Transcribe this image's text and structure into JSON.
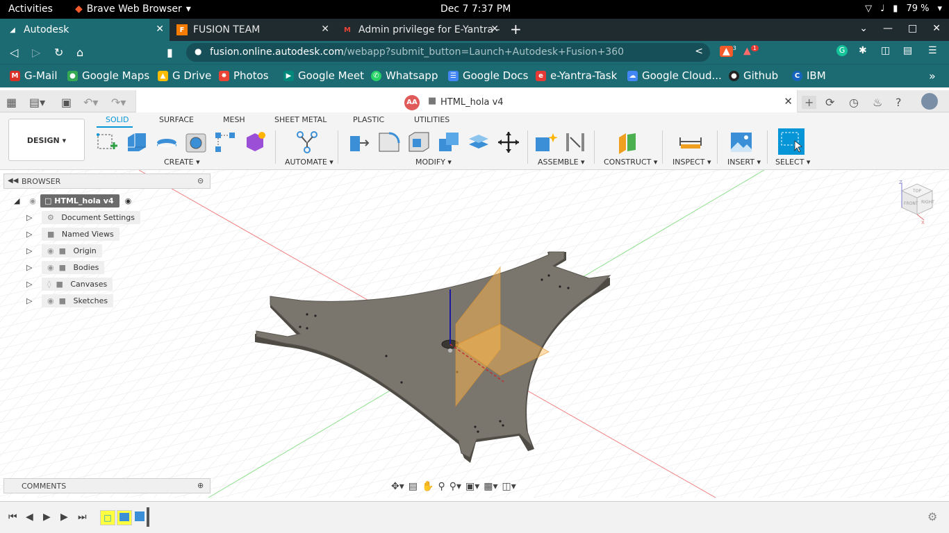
{
  "system": {
    "activities": "Activities",
    "app_name": "Brave Web Browser",
    "clock": "Dec 7   7:37 PM",
    "battery": "79 %"
  },
  "tabs": [
    {
      "title": "Autodesk",
      "active": true
    },
    {
      "title": "FUSION TEAM",
      "active": false
    },
    {
      "title": "Admin privilege for E-Yantra -",
      "active": false
    }
  ],
  "address": {
    "host": "fusion.online.autodesk.com",
    "path": "/webapp?submit_button=Launch+Autodesk+Fusion+360"
  },
  "extensions": {
    "brave_count": "3",
    "alert_count": "1"
  },
  "bookmarks": [
    {
      "label": "G-Mail",
      "color": "#d93025"
    },
    {
      "label": "Google Maps",
      "color": "#34a853"
    },
    {
      "label": "G Drive",
      "color": "#fbbc04"
    },
    {
      "label": "Photos",
      "color": "#ea4335"
    },
    {
      "label": "Google Meet",
      "color": "#00897b"
    },
    {
      "label": "Whatsapp",
      "color": "#25d366"
    },
    {
      "label": "Google Docs",
      "color": "#4285f4"
    },
    {
      "label": "e-Yantra-Task",
      "color": "#e53935"
    },
    {
      "label": "Google Cloud...",
      "color": "#4285f4"
    },
    {
      "label": "Github",
      "color": "#222222"
    },
    {
      "label": "IBM",
      "color": "#1565c0"
    }
  ],
  "app": {
    "user_initials": "AA",
    "doc_name": "HTML_hola v4"
  },
  "ribbon": {
    "workspace": "DESIGN",
    "tabs": [
      "SOLID",
      "SURFACE",
      "MESH",
      "SHEET METAL",
      "PLASTIC",
      "UTILITIES"
    ],
    "groups": [
      "CREATE",
      "AUTOMATE",
      "MODIFY",
      "ASSEMBLE",
      "CONSTRUCT",
      "INSPECT",
      "INSERT",
      "SELECT"
    ]
  },
  "browser_panel": {
    "title": "BROWSER",
    "root": "HTML_hola v4",
    "items": [
      "Document Settings",
      "Named Views",
      "Origin",
      "Bodies",
      "Canvases",
      "Sketches"
    ]
  },
  "comments_panel": {
    "title": "COMMENTS"
  },
  "viewcube": {
    "top": "TOP",
    "front": "FRONT",
    "right": "RIGHT",
    "axis_z": "Z",
    "axis_x": "X"
  },
  "accent": "#0696d7"
}
